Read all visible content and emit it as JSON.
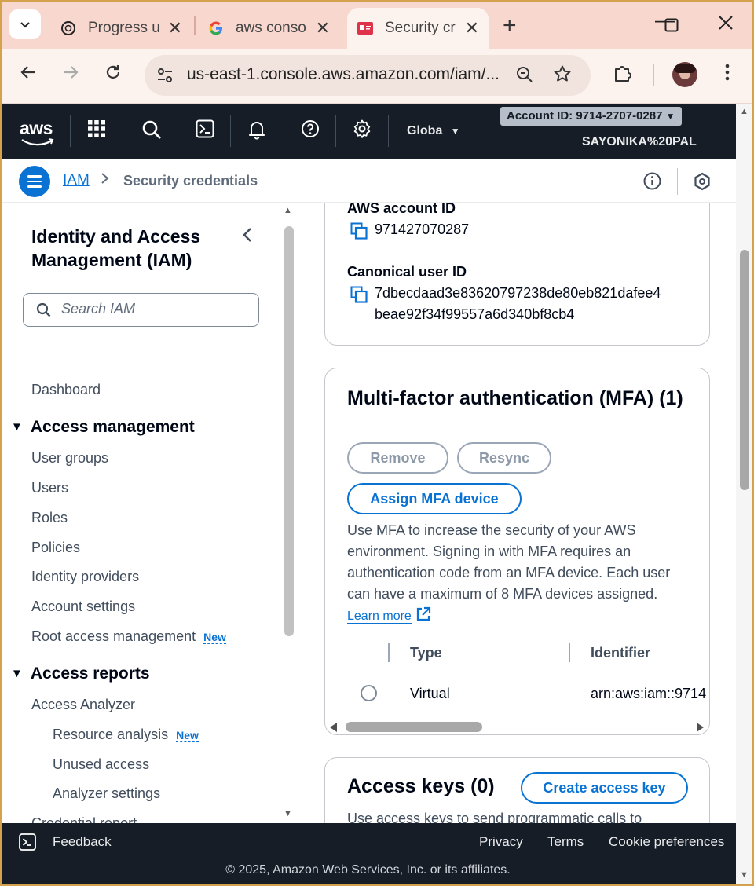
{
  "browser": {
    "tabs": [
      {
        "title": "Progress u",
        "icon": "chatgpt-icon"
      },
      {
        "title": "aws consol",
        "icon": "google-icon"
      },
      {
        "title": "Security cr",
        "icon": "aws-security-icon"
      }
    ],
    "url": "us-east-1.console.aws.amazon.com/iam/..."
  },
  "aws_header": {
    "logo": "aws",
    "region": "Globa",
    "account_id": "Account ID: 9714-2707-0287",
    "username": "SAYONIKA%20PAL"
  },
  "breadcrumb": {
    "root": "IAM",
    "current": "Security credentials"
  },
  "sidebar": {
    "title": "Identity and Access Management (IAM)",
    "search_placeholder": "Search IAM",
    "dashboard": "Dashboard",
    "access_management": {
      "label": "Access management",
      "items": [
        "User groups",
        "Users",
        "Roles",
        "Policies",
        "Identity providers",
        "Account settings",
        "Root access management"
      ],
      "badge": "New"
    },
    "access_reports": {
      "label": "Access reports",
      "analyzer": "Access Analyzer",
      "sub_items": [
        "Resource analysis",
        "Unused access",
        "Analyzer settings"
      ],
      "badge": "New",
      "credential_report": "Credential report"
    }
  },
  "account_details": {
    "account_id_label": "AWS account ID",
    "account_id_value": "971427070287",
    "canonical_label": "Canonical user ID",
    "canonical_line1": "7dbecdaad3e83620797238de80eb821dafee4",
    "canonical_line2": "beae92f34f99557a6d340bf8cb4"
  },
  "mfa": {
    "title": "Multi-factor authentication (MFA)",
    "count": "(1)",
    "remove": "Remove",
    "resync": "Resync",
    "assign": "Assign MFA device",
    "description": "Use MFA to increase the security of your AWS environment. Signing in with MFA requires an authentication code from an MFA device. Each user can have a maximum of 8 MFA devices assigned.",
    "learn_more": "Learn more",
    "columns": [
      "Type",
      "Identifier"
    ],
    "rows": [
      {
        "type": "Virtual",
        "identifier": "arn:aws:iam::9714"
      }
    ]
  },
  "access_keys": {
    "title": "Access keys (0)",
    "create": "Create access key",
    "description": "Use access keys to send programmatic calls to"
  },
  "footer": {
    "feedback": "Feedback",
    "privacy": "Privacy",
    "terms": "Terms",
    "cookies": "Cookie preferences",
    "copyright": "© 2025, Amazon Web Services, Inc. or its affiliates."
  }
}
